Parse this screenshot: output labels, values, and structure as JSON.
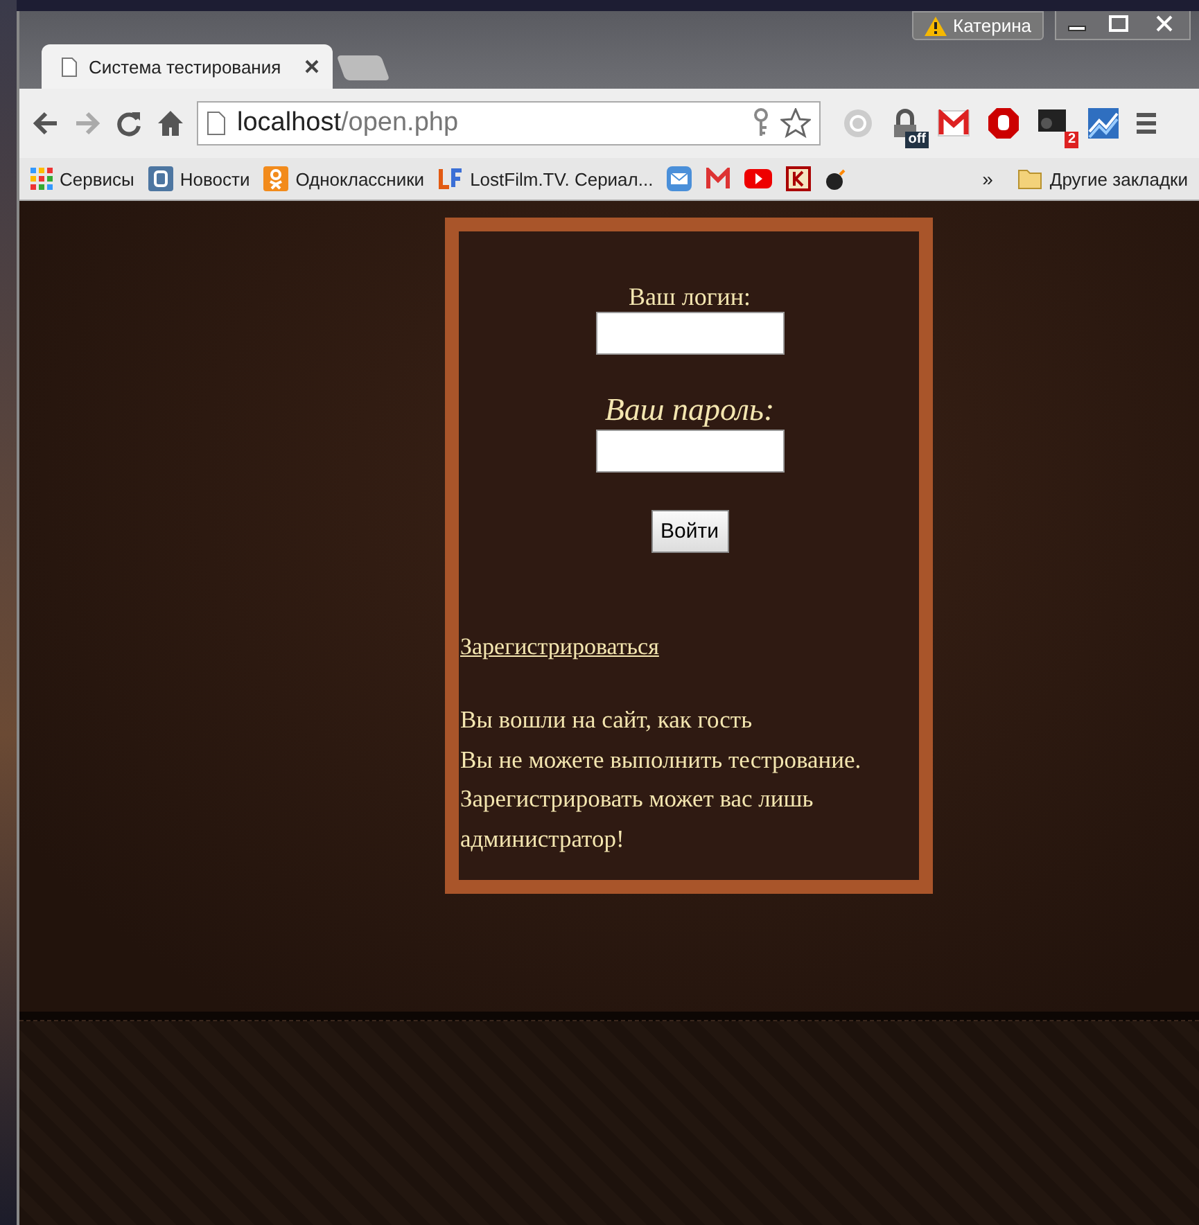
{
  "window": {
    "user": "Катерина"
  },
  "tabs": [
    {
      "title": "Система тестирования",
      "selected": true
    }
  ],
  "address": {
    "host": "localhost",
    "path": "/open.php"
  },
  "extensions": [
    {
      "kind": "power"
    },
    {
      "kind": "lock",
      "badge": "off"
    },
    {
      "kind": "mail"
    },
    {
      "kind": "stop"
    },
    {
      "kind": "dark",
      "badge": "2"
    },
    {
      "kind": "chart"
    }
  ],
  "bookmarks": [
    {
      "kind": "apps",
      "label": "Сервисы"
    },
    {
      "kind": "blue",
      "label": "Новости"
    },
    {
      "kind": "orange",
      "label": "Одноклассники"
    },
    {
      "kind": "lf",
      "label": "LostFilm.TV. Сериал..."
    },
    {
      "kind": "envelope"
    },
    {
      "kind": "mail"
    },
    {
      "kind": "video"
    },
    {
      "kind": "red"
    },
    {
      "kind": "bomb"
    }
  ],
  "bookmarks_more": "»",
  "other_bookmarks": "Другие закладки",
  "form": {
    "login_label": "Ваш логин:",
    "password_label": "Ваш пароль:",
    "submit": "Войти",
    "register_link": "Зарегистрироваться",
    "messages": [
      "Вы вошли на сайт, как гость",
      "Вы не можете выполнить тестрование.",
      "Зарегистрировать может вас лишь администратор!"
    ]
  }
}
